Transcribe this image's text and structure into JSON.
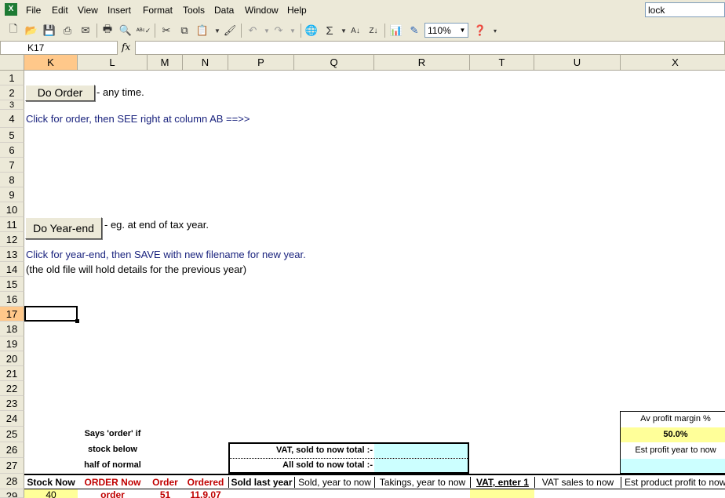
{
  "menu": {
    "items": [
      "File",
      "Edit",
      "View",
      "Insert",
      "Format",
      "Tools",
      "Data",
      "Window",
      "Help"
    ],
    "underline": [
      "F",
      "E",
      "V",
      "I",
      "o",
      "T",
      "D",
      "W",
      "H"
    ],
    "search_value": "lock"
  },
  "toolbar": {
    "zoom_value": "110%",
    "sigma": "Σ"
  },
  "formula_bar": {
    "name_box": "K17",
    "fx": "fx",
    "formula": ""
  },
  "columns": [
    "K",
    "L",
    "M",
    "N",
    "P",
    "Q",
    "R",
    "T",
    "U",
    "X"
  ],
  "rows": [
    "1",
    "2",
    "3",
    "4",
    "5",
    "6",
    "7",
    "8",
    "9",
    "10",
    "11",
    "12",
    "13",
    "14",
    "15",
    "16",
    "17",
    "18",
    "19",
    "20",
    "21",
    "22",
    "23",
    "24",
    "25",
    "26",
    "27",
    "28",
    "29"
  ],
  "selected": {
    "column": "K",
    "row": "17"
  },
  "sheet": {
    "do_order_button": "Do Order",
    "do_order_note": "- any time.",
    "order_hint": "Click for order, then SEE right at column AB ==>>",
    "do_yearend_button": "Do Year-end",
    "yearend_note": "- eg. at end of tax year.",
    "yearend_hint": "Click for year-end, then SAVE with new filename for new year.",
    "yearend_hint2": "(the old file will hold details for the previous year)",
    "says_order_1": "Says 'order' if",
    "says_order_2": "stock below",
    "says_order_3": "half of normal",
    "vat_sold_label": "VAT, sold to now total :-",
    "all_sold_label": "All sold to now total :-",
    "av_profit_label": "Av profit margin %",
    "av_profit_value": "50.0%",
    "est_profit_label": "Est profit year to now",
    "headers": {
      "stock_now": "Stock Now",
      "order_now": "ORDER Now",
      "order": "Order",
      "ordered": "Ordered",
      "sold_last_year": "Sold last year",
      "sold_year_to_now": "Sold, year to now",
      "takings_year_to_now": "Takings, year to now",
      "vat_enter": "VAT, enter 1",
      "vat_sales": "VAT sales to now",
      "est_product_profit": "Est product profit to now"
    },
    "row29": {
      "stock": "40",
      "order_now": "order",
      "order": "51",
      "ordered": "11.9.07"
    }
  }
}
